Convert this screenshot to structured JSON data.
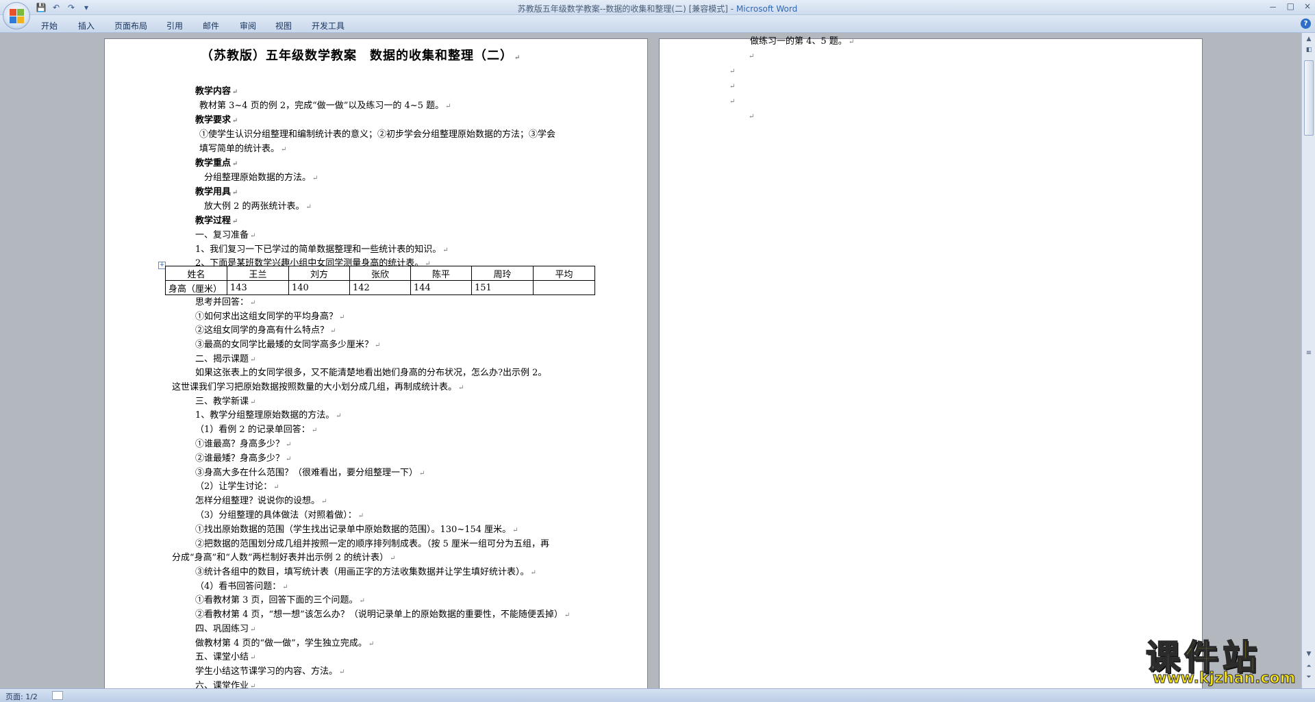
{
  "window": {
    "title_doc": "苏教版五年级数学教案--数据的收集和整理(二) [兼容模式] - ",
    "title_app": "Microsoft Word",
    "controls": [
      "－",
      "□",
      "×"
    ]
  },
  "qat": {
    "save_icon": "💾",
    "undo_icon": "↶",
    "redo_icon": "↷",
    "more_icon": "▾"
  },
  "ribbon": {
    "tabs": [
      "开始",
      "插入",
      "页面布局",
      "引用",
      "邮件",
      "审阅",
      "视图",
      "开发工具"
    ],
    "help": "?"
  },
  "page1": {
    "title": "（苏教版）五年级数学教案　数据的收集和整理（二）",
    "lines": [
      "教学内容",
      "教材第 3~4 页的例 2，完成“做一做”以及练习一的 4~5 题。",
      "教学要求",
      "①使学生认识分组整理和编制统计表的意义；②初步学会分组整理原始数据的方法；③学会",
      "填写简单的统计表。",
      "教学重点",
      "分组整理原始数据的方法。",
      "教学用具",
      "放大例 2 的两张统计表。",
      "教学过程",
      "一、复习准备",
      "1、我们复习一下已学过的简单数据整理和一些统计表的知识。",
      "2、下面是某班数学兴趣小组中女同学测量身高的统计表。",
      "思考并回答：",
      "①如何求出这组女同学的平均身高？",
      "②这组女同学的身高有什么特点？",
      "③最高的女同学比最矮的女同学高多少厘米？",
      "二、揭示课题",
      "如果这张表上的女同学很多，又不能清楚地看出她们身高的分布状况，怎么办?出示例 2。",
      "这世课我们学习把原始数据按照数量的大小划分成几组，再制成统计表。",
      "三、教学新课",
      "1、教学分组整理原始数据的方法。",
      "（1）看例 2 的记录单回答：",
      "①谁最高？身高多少？",
      "②谁最矮？身高多少？",
      "③身高大多在什么范围？（很难看出，要分组整理一下）",
      "（2）让学生讨论：",
      "怎样分组整理？说说你的设想。",
      "（3）分组整理的具体做法（对照着做）：",
      "①找出原始数据的范围（学生找出记录单中原始数据的范围）。130~154 厘米。",
      "②把数据的范围划分成几组并按照一定的顺序排列制成表。（按 5 厘米一组可分为五组，再",
      "分成“身高”和“人数”两栏制好表并出示例 2 的统计表）",
      "③统计各组中的数目，填写统计表（用画正字的方法收集数据并让学生填好统计表）。",
      "（4）看书回答问题：",
      "①看教材第 3 页，回答下面的三个问题。",
      "②看教材第 4 页，“想一想”该怎么办？（说明记录单上的原始数据的重要性，不能随便丢掉）",
      "四、巩固练习",
      "做教材第 4 页的“做一做”，学生独立完成。",
      "五、课堂小结",
      "学生小结这节课学习的内容、方法。",
      "六、课堂作业"
    ],
    "table": {
      "header": [
        "姓名",
        "王兰",
        "刘方",
        "张欣",
        "陈平",
        "周玲",
        "平均"
      ],
      "row": [
        "身高（厘米）",
        "143",
        "140",
        "142",
        "144",
        "151",
        ""
      ]
    }
  },
  "page2": {
    "line1": "做练习一的第 4、5 题。",
    "mark": "↵"
  },
  "status": {
    "page": "页面: 1/2"
  },
  "watermark": {
    "main": "课件站",
    "url": "www.kjzhan.com"
  }
}
